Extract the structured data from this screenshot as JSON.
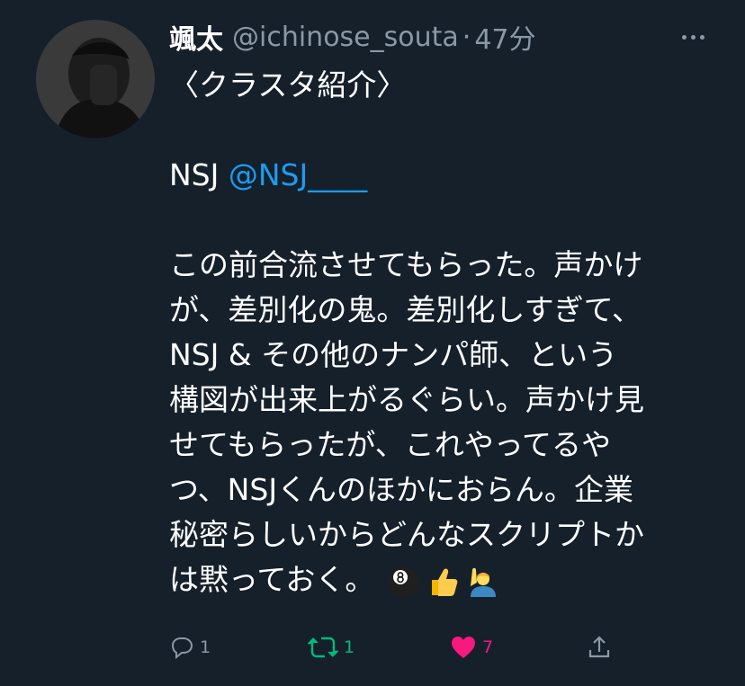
{
  "tweet": {
    "display_name": "颯太",
    "handle": "@ichinose_souta",
    "separator": "·",
    "time": "47分",
    "lines": {
      "l1": "〈クラスタ紹介〉",
      "l3_prefix": "NSJ ",
      "l3_mention": "@NSJ____",
      "l5": "この前合流させてもらった。声かけ",
      "l6": "が、差別化の鬼。差別化しすぎて、",
      "l7": "NSJ & その他のナンパ師、という",
      "l8": "構図が出来上がるぐらい。声かけ見",
      "l9": "せてもらったが、これやってるや",
      "l10": "つ、NSJくんのほかにおらん。企業",
      "l11": "秘密らしいからどんなスクリプトか",
      "l12": "は黙っておく。"
    },
    "emojis": [
      "8-ball-emoji",
      "thumbs-up-emoji",
      "person-raising-hand-emoji"
    ]
  },
  "actions": {
    "reply_count": "1",
    "retweet_count": "1",
    "like_count": "7"
  },
  "colors": {
    "background": "#15202b",
    "text": "#ffffff",
    "muted": "#8b98a5",
    "link": "#1d9bf0",
    "retweet": "#00ba7c",
    "like": "#f91880"
  }
}
